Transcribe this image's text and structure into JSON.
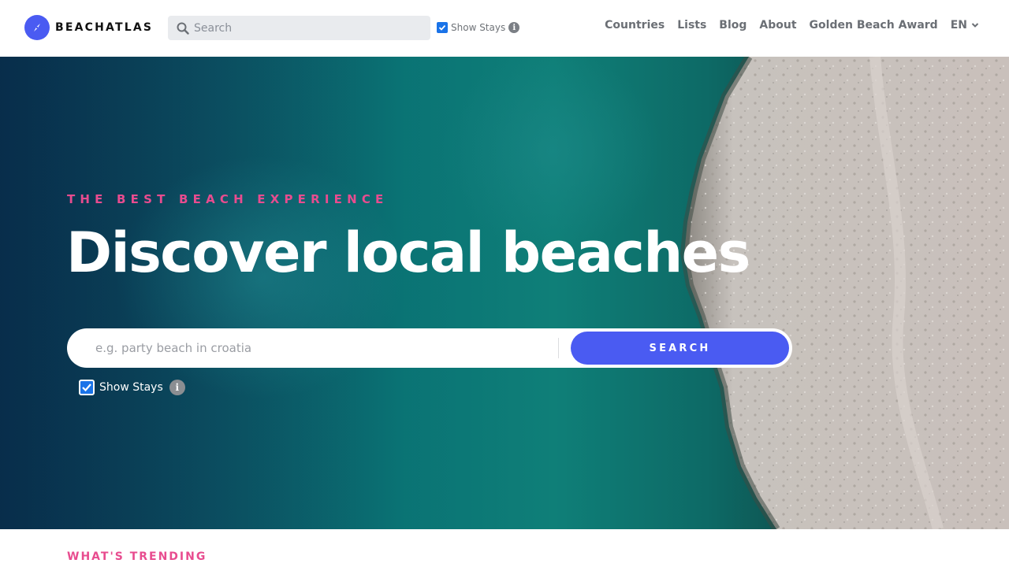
{
  "colors": {
    "brand": "#4a5bf2",
    "accent_pink": "#e84c8f",
    "checkbox_blue": "#1a73e8"
  },
  "header": {
    "logo_text": "BEACHATLAS",
    "logo_icon": "compass-icon",
    "search": {
      "placeholder": "Search",
      "value": ""
    },
    "show_stays_label": "Show Stays",
    "show_stays_checked": true,
    "nav_items": [
      "Countries",
      "Lists",
      "Blog",
      "About",
      "Golden Beach Award"
    ],
    "language": "EN"
  },
  "hero": {
    "eyebrow": "THE BEST BEACH EXPERIENCE",
    "title": "Discover local beaches",
    "search": {
      "placeholder": "e.g. party beach in croatia",
      "value": ""
    },
    "search_button": "SEARCH",
    "show_stays_label": "Show Stays",
    "show_stays_checked": true,
    "info_glyph": "i"
  },
  "trending": {
    "label": "WHAT'S TRENDING"
  }
}
